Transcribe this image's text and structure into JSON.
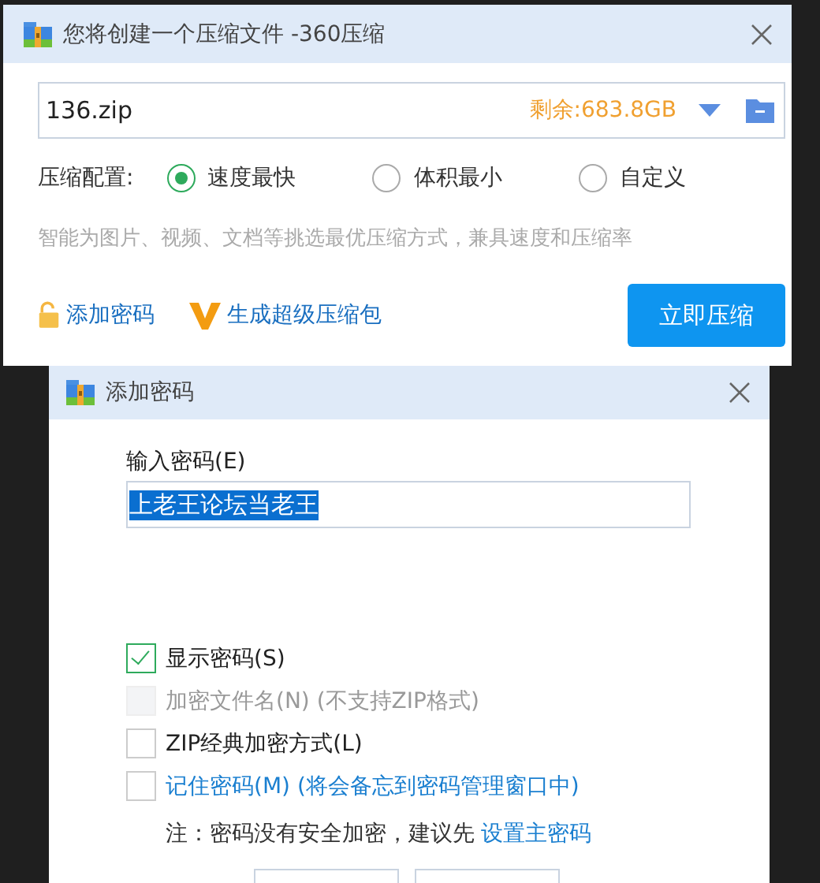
{
  "main_window": {
    "title": "您将创建一个压缩文件 -360压缩",
    "file_name": "136.zip",
    "free_space": "剩余:683.8GB",
    "config_label": "压缩配置:",
    "options": [
      {
        "label": "速度最快",
        "selected": true
      },
      {
        "label": "体积最小",
        "selected": false
      },
      {
        "label": "自定义",
        "selected": false
      }
    ],
    "hint": "智能为图片、视频、文档等挑选最优压缩方式，兼具速度和压缩率",
    "links": [
      {
        "kind": "lock",
        "label": "添加密码"
      },
      {
        "kind": "vip",
        "label": "生成超级压缩包"
      }
    ],
    "compress_button": "立即压缩"
  },
  "password_dialog": {
    "title": "添加密码",
    "input_label": "输入密码(E)",
    "password": "上老王论坛当老王",
    "password_selected": true,
    "checkboxes": [
      {
        "label": "显示密码(S)",
        "checked": true,
        "disabled": false,
        "link": false
      },
      {
        "label": "加密文件名(N) (不支持ZIP格式)",
        "checked": false,
        "disabled": true,
        "link": false
      },
      {
        "label": "ZIP经典加密方式(L)",
        "checked": false,
        "disabled": false,
        "link": false
      },
      {
        "label": "记住密码(M) (将会备忘到密码管理窗口中)",
        "checked": false,
        "disabled": false,
        "link": true
      }
    ],
    "note": "注：密码没有安全加密，建议先",
    "note_link": "设置主密码"
  }
}
